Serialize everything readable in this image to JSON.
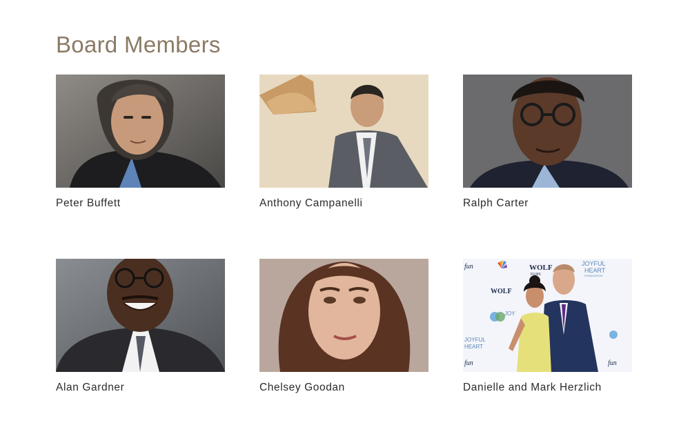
{
  "section": {
    "title": "Board Members"
  },
  "members": [
    {
      "name": "Peter Buffett",
      "photo": "peter-buffett-photo"
    },
    {
      "name": "Anthony Campanelli",
      "photo": "anthony-campanelli-photo"
    },
    {
      "name": "Ralph Carter",
      "photo": "ralph-carter-photo"
    },
    {
      "name": "Alan Gardner",
      "photo": "alan-gardner-photo"
    },
    {
      "name": "Chelsey Goodan",
      "photo": "chelsey-goodan-photo"
    },
    {
      "name": "Danielle and Mark Herzlich",
      "photo": "danielle-mark-herzlich-photo"
    }
  ],
  "backdrop_logos": {
    "wolf": "WOLF",
    "films": "FILMS",
    "joyful": "JOYFUL",
    "heart": "HEART",
    "foundation": "FOUNDATION",
    "fun": "fun",
    "joy": "JOY"
  },
  "colors": {
    "title": "#8b7a64",
    "name_text": "#2b2b2b"
  }
}
